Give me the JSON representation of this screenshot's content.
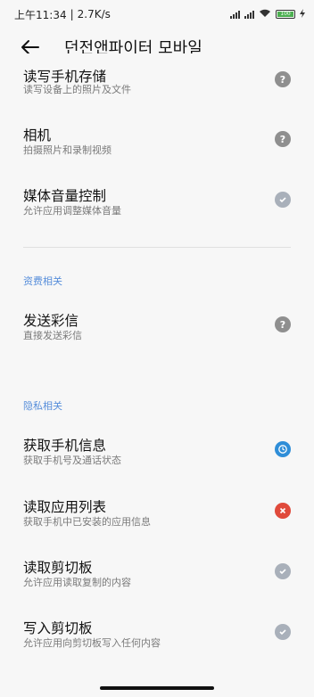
{
  "status_bar": {
    "time": "上午11:34",
    "separator": "|",
    "speed": "2.7K/s",
    "battery": "100"
  },
  "header": {
    "title": "던전앤파이터 모바일"
  },
  "sections": {
    "finance_header": "资费相关",
    "privacy_header": "隐私相关"
  },
  "permissions": [
    {
      "title": "读写手机存储",
      "desc": "读写设备上的照片及文件",
      "status": "ask",
      "status_icon": "question-icon"
    },
    {
      "title": "相机",
      "desc": "拍摄照片和录制视频",
      "status": "ask",
      "status_icon": "question-icon"
    },
    {
      "title": "媒体音量控制",
      "desc": "允许应用调整媒体音量",
      "status": "allow",
      "status_icon": "shield-check-icon"
    },
    {
      "title": "发送彩信",
      "desc": "直接发送彩信",
      "status": "ask",
      "status_icon": "question-icon"
    },
    {
      "title": "获取手机信息",
      "desc": "获取手机号及通话状态",
      "status": "allow-in-use",
      "status_icon": "clock-icon"
    },
    {
      "title": "读取应用列表",
      "desc": "获取手机中已安装的应用信息",
      "status": "deny",
      "status_icon": "cross-icon"
    },
    {
      "title": "读取剪切板",
      "desc": "允许应用读取复制的内容",
      "status": "allow",
      "status_icon": "shield-check-icon"
    },
    {
      "title": "写入剪切板",
      "desc": "允许应用向剪切板写入任何内容",
      "status": "allow",
      "status_icon": "shield-check-icon"
    }
  ],
  "colors": {
    "accent": "#3a7bd5",
    "deny": "#e04a3b",
    "allow_in_use": "#2f8ed8",
    "ask": "#8f8f8f",
    "allow": "#a9b0ba"
  }
}
